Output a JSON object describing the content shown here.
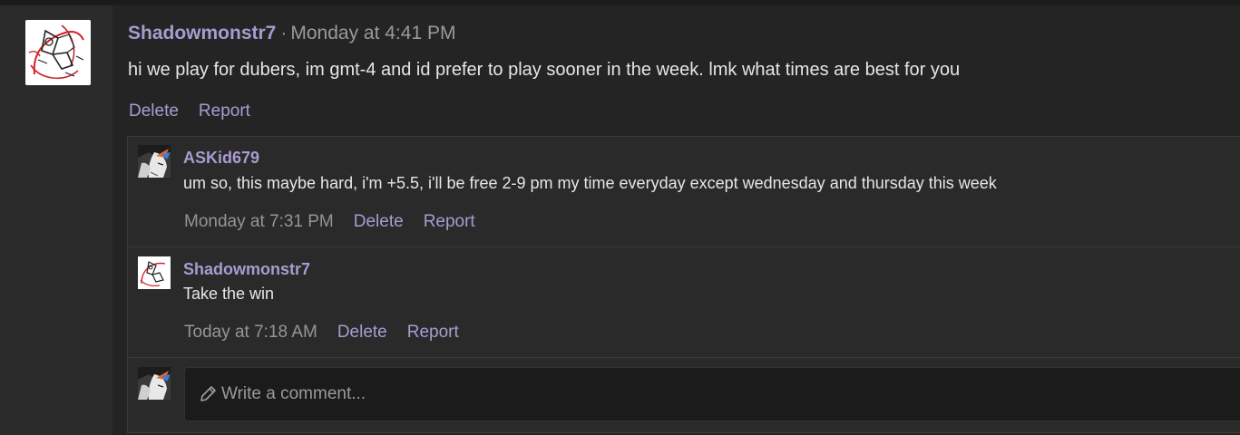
{
  "post": {
    "author": "Shadowmonstr7",
    "separator": "·",
    "time": "Monday at 4:41 PM",
    "body": "hi we play for dubers, im gmt-4 and id prefer to play sooner in the week. lmk what times are best for you",
    "actions": {
      "delete": "Delete",
      "report": "Report"
    }
  },
  "comments": [
    {
      "author": "ASKid679",
      "body": "um so, this maybe hard, i'm +5.5, i'll be free 2-9 pm my time everyday except wednesday and thursday this week",
      "time": "Monday at 7:31 PM",
      "delete": "Delete",
      "report": "Report"
    },
    {
      "author": "Shadowmonstr7",
      "body": "Take the win",
      "time": "Today at 7:18 AM",
      "delete": "Delete",
      "report": "Report"
    }
  ],
  "composer": {
    "placeholder": "Write a comment..."
  },
  "icons": {
    "author_avatar": "sketch-avatar-icon",
    "commenter_avatar": "anime-avatar-icon",
    "composer": "pencil-icon"
  },
  "colors": {
    "accent": "#a99bd1",
    "text": "#e6e6e6",
    "muted": "#9a9a9a",
    "background": "#242424"
  }
}
